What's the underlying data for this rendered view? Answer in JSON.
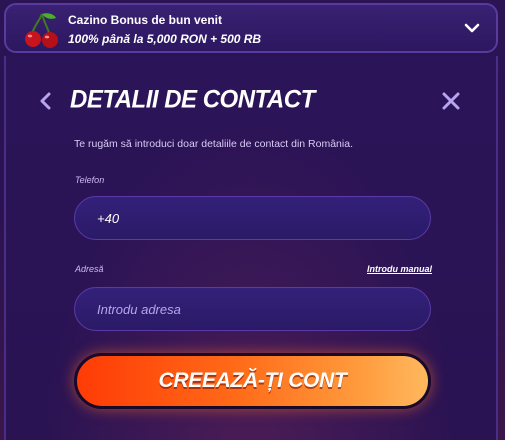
{
  "banner": {
    "title": "Cazino Bonus de bun venit",
    "subtitle": "100% până la 5,000 RON + 500 RB",
    "icon": "cherries-icon"
  },
  "form": {
    "heading": "DETALII DE CONTACT",
    "note": "Te rugăm să introduci doar detaliile de contact din România.",
    "phone": {
      "label": "Telefon",
      "value": "+40"
    },
    "address": {
      "label": "Adresă",
      "placeholder": "Introdu adresa",
      "manual_link": "Introdu manual"
    },
    "submit_label": "CREEAZĂ-ȚI CONT"
  },
  "colors": {
    "background": "#2a1352",
    "field": "#2e1d70",
    "field_border": "#5b3aa8",
    "cta_start": "#ff3b06",
    "cta_end": "#ffb85e"
  }
}
